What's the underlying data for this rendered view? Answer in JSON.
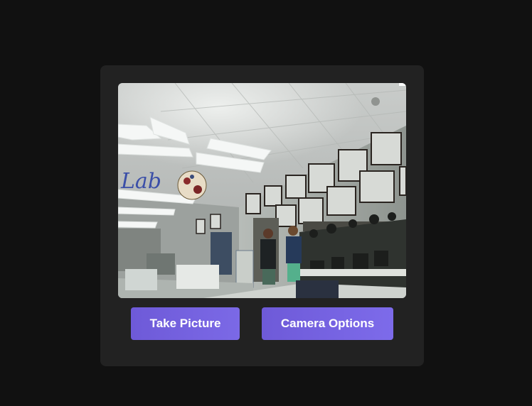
{
  "camera": {
    "sign_text": "Lab"
  },
  "actions": {
    "take_picture_label": "Take Picture",
    "camera_options_label": "Camera Options"
  },
  "colors": {
    "page_background": "#111111",
    "card_background": "#222222",
    "button_primary": "#7563e0",
    "button_text": "#ffffff"
  }
}
